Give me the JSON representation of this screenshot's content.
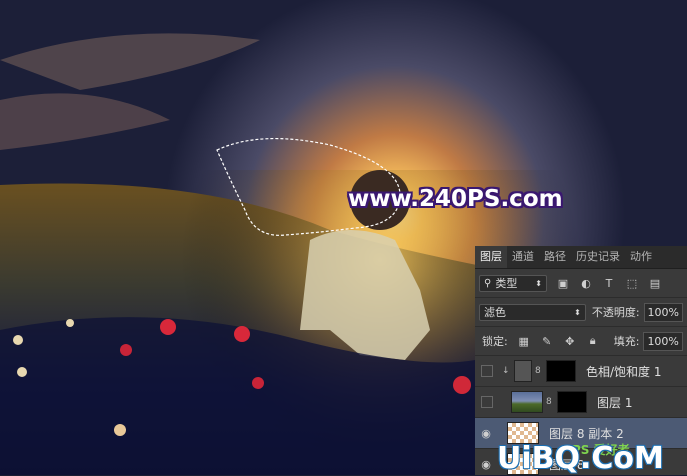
{
  "watermark": "www.240PS.com",
  "panel": {
    "tabs": [
      "图层",
      "通道",
      "路径",
      "历史记录",
      "动作"
    ],
    "active_tab": 0,
    "filter_kind": "类型",
    "blend_mode": "滤色",
    "opacity_label": "不透明度:",
    "opacity_value": "100%",
    "lock_label": "锁定:",
    "fill_label": "填充:",
    "fill_value": "100%",
    "layers": [
      {
        "name": "色相/饱和度 1",
        "visible": false,
        "thumb": "adjust",
        "selected": false
      },
      {
        "name": "图层 1",
        "visible": false,
        "thumb": "photo",
        "selected": false
      },
      {
        "name": "图层 8 副本 2",
        "visible": true,
        "thumb": "checker",
        "selected": true
      },
      {
        "name": "图层 8",
        "visible": true,
        "thumb": "checker",
        "selected": false
      }
    ]
  },
  "site_logo": {
    "main": "UiBQ.CoM",
    "badge": "PS 爱好者"
  },
  "colors": {
    "panel_bg": "#3a3a3a",
    "selected_row": "#4c5a74",
    "watermark_stroke": "#3a1870"
  }
}
